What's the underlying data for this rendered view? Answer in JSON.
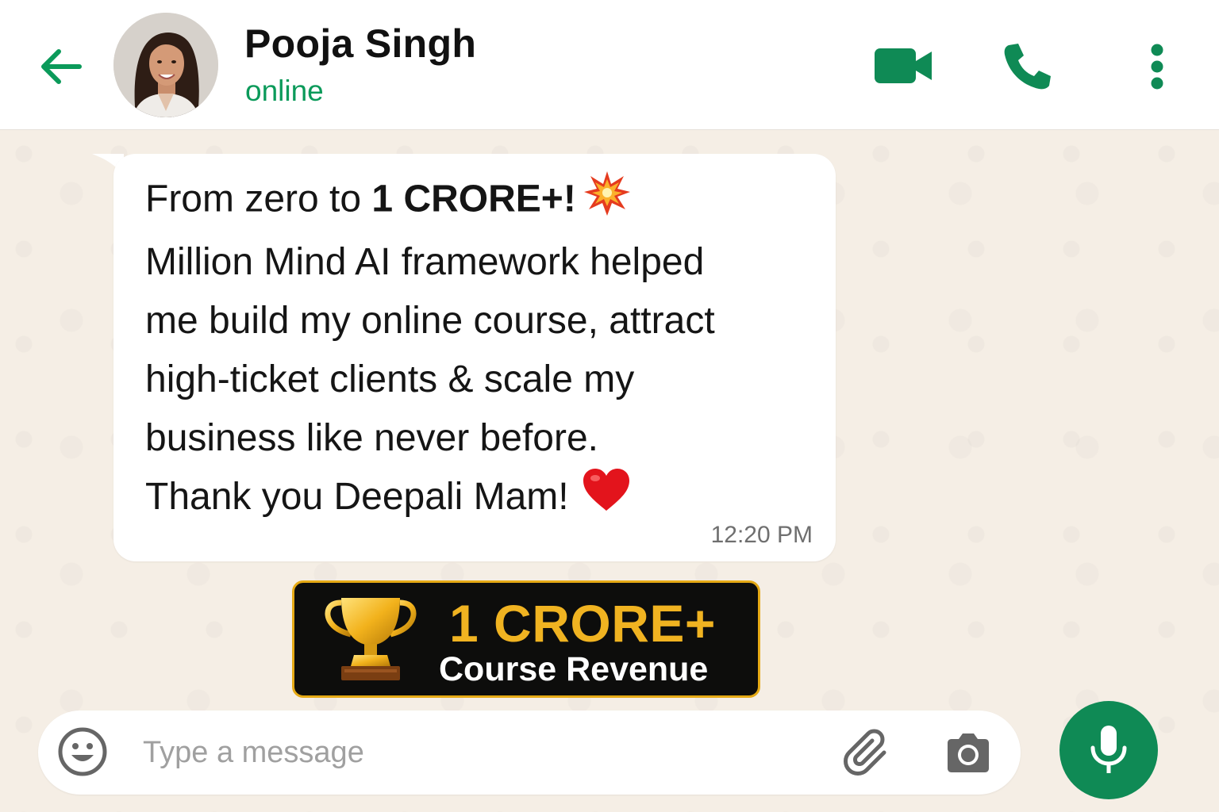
{
  "header": {
    "contact_name": "Pooja Singh",
    "status": "online",
    "icons": {
      "back": "arrow-left-icon",
      "video": "video-call-icon",
      "voice": "phone-call-icon",
      "menu": "more-vert-icon"
    }
  },
  "message": {
    "lines": [
      {
        "text": "From zero to ",
        "bold": "1 CRORE+!",
        "emoji": "collision-emoji"
      },
      {
        "text": "Million Mind AI framework helped"
      },
      {
        "text": "me build my online course, attract"
      },
      {
        "text": "high-ticket clients & scale my"
      },
      {
        "text": "business like never before."
      },
      {
        "text": "Thank you Deepali Mam!",
        "emoji": "red-heart-emoji"
      }
    ],
    "time": "12:20 PM"
  },
  "badge": {
    "icon": "trophy-icon",
    "title": "1 CRORE+",
    "subtitle": "Course Revenue"
  },
  "composer": {
    "placeholder": "Type a message",
    "icons": {
      "emoji": "emoji-icon",
      "attach": "paperclip-icon",
      "camera": "camera-icon",
      "mic": "microphone-icon"
    }
  },
  "colors": {
    "accent": "#0b9a5a",
    "mic_button": "#0f8a55",
    "badge_gold": "#f0b321",
    "badge_bg": "#0d0d0c",
    "chat_bg": "#f5eee5"
  }
}
